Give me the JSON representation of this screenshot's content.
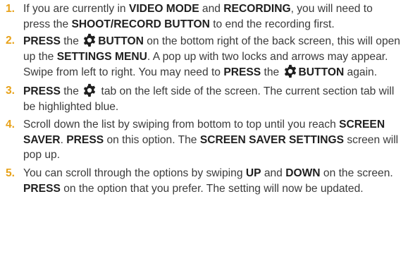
{
  "steps": [
    {
      "num": "1.",
      "parts": [
        "If you are currently in ",
        "VIDEO MODE",
        " and ",
        "RECORDING",
        ", you will need to press the ",
        "SHOOT/RECORD BUTTON",
        " to end the recording first."
      ]
    },
    {
      "num": "2.",
      "parts": [
        "PRESS",
        " the ",
        "BUTTON",
        " on the bottom right of the back screen, this will open up the ",
        "SETTINGS MENU",
        ". A pop up with two locks and arrows may appear. Swipe from left to right. You may need to ",
        "PRESS",
        " the ",
        "BUTTON",
        " again."
      ]
    },
    {
      "num": "3.",
      "parts": [
        "PRESS",
        " the ",
        " tab on the left side of the screen. The current section tab will be highlighted blue."
      ]
    },
    {
      "num": "4.",
      "parts": [
        "Scroll down the list by swiping from bottom to top until you reach ",
        "SCREEN SAVER",
        ". ",
        "PRESS",
        " on this option. The ",
        "SCREEN SAVER SETTINGS",
        " screen will pop up."
      ]
    },
    {
      "num": "5.",
      "parts": [
        "You can scroll through the options by swiping ",
        "UP",
        " and ",
        "DOWN",
        " on the screen. ",
        "PRESS",
        " on the option that you prefer. The setting will now be updated."
      ]
    }
  ],
  "icons": {
    "settings": "gear-icon"
  },
  "colors": {
    "number": "#e8a21a",
    "text": "#3a3a3a",
    "bold": "#1f1f1f"
  }
}
